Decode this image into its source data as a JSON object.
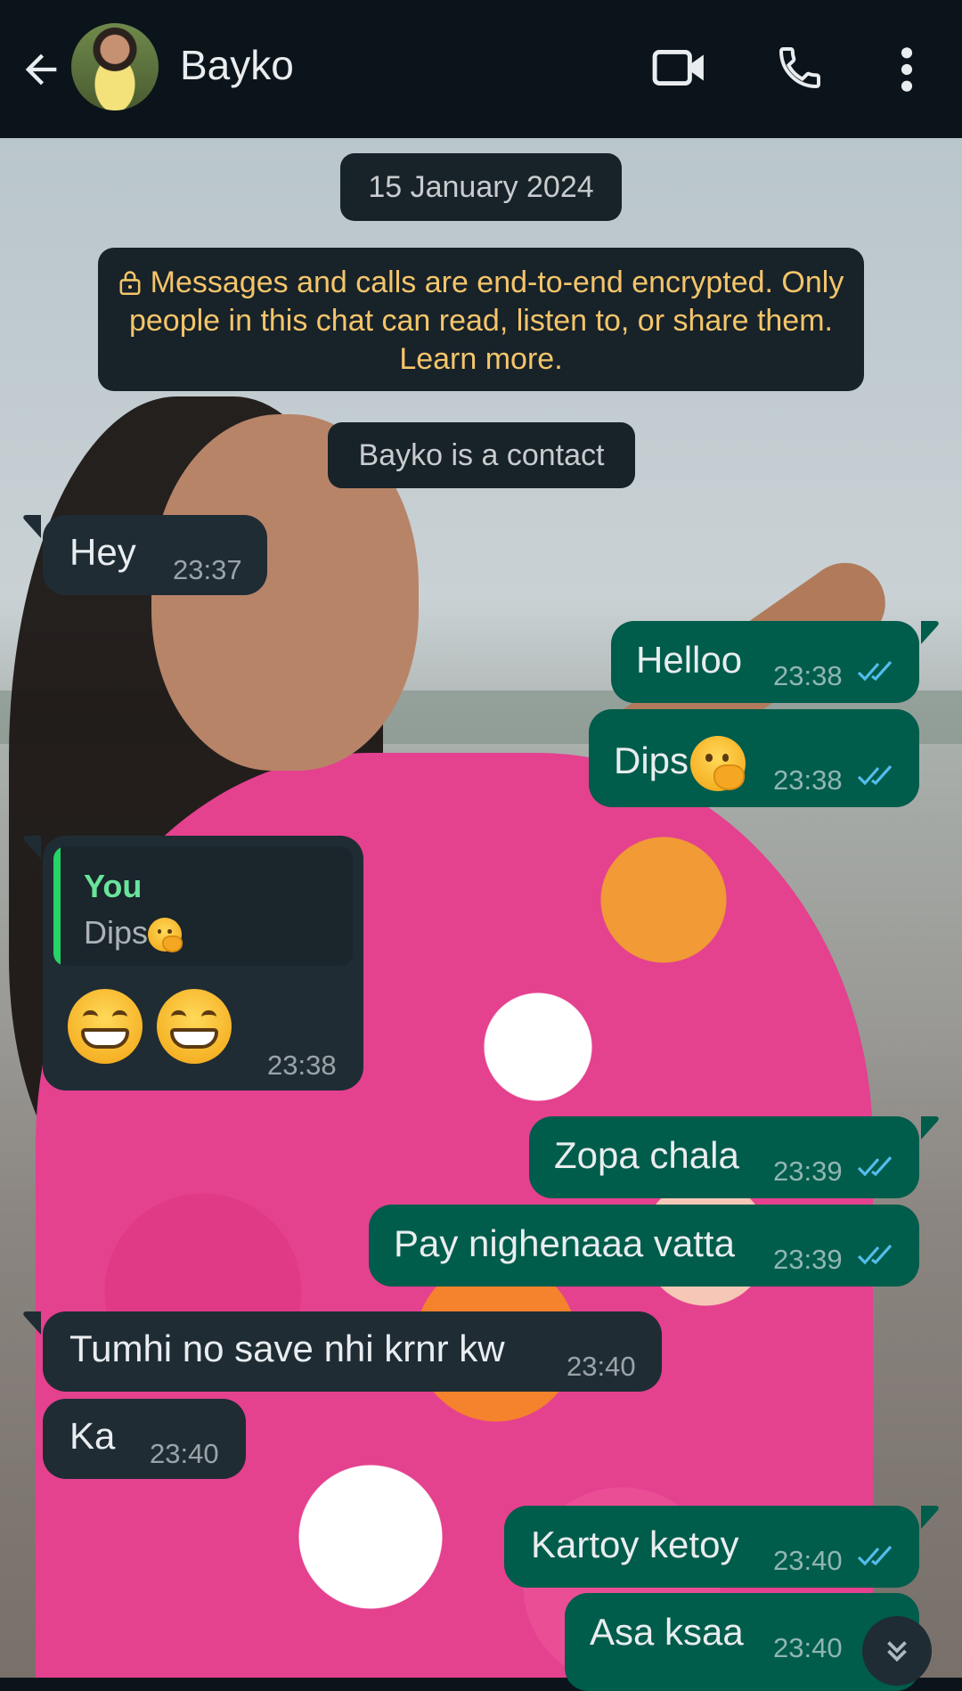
{
  "header": {
    "contact_name": "Bayko",
    "icons": [
      "back-arrow-icon",
      "avatar",
      "video-call-icon",
      "phone-icon",
      "more-options-icon"
    ]
  },
  "chat": {
    "date_label": "15 January 2024",
    "encryption_notice": "Messages and calls are end-to-end encrypted. Only people in this chat can read, listen to, or share them. Learn more.",
    "contact_notice": "Bayko is a contact",
    "messages": [
      {
        "dir": "in",
        "text": "Hey",
        "time": "23:37"
      },
      {
        "dir": "out",
        "text": "Helloo",
        "time": "23:38",
        "status": "read"
      },
      {
        "dir": "out",
        "text": "Dips",
        "emoji": "hand-over-mouth",
        "time": "23:38",
        "status": "read"
      },
      {
        "dir": "in",
        "reply_to": {
          "author": "You",
          "text": "Dips",
          "emoji": "hand-over-mouth"
        },
        "emoji": "grinning-x2",
        "time": "23:38"
      },
      {
        "dir": "out",
        "text": "Zopa chala",
        "time": "23:39",
        "status": "read"
      },
      {
        "dir": "out",
        "text": "Pay nighenaaa vatta",
        "time": "23:39",
        "status": "read"
      },
      {
        "dir": "in",
        "text": "Tumhi no save nhi krnr kw",
        "time": "23:40"
      },
      {
        "dir": "in",
        "text": "Ka",
        "time": "23:40"
      },
      {
        "dir": "out",
        "text": "Kartoy ketoy",
        "time": "23:40",
        "status": "read"
      },
      {
        "dir": "out",
        "text": "Asa ksaa",
        "time": "23:40"
      }
    ]
  },
  "colors": {
    "bar_bg": "#0b141a",
    "incoming_bubble": "#1f2c34",
    "outgoing_bubble": "#005c4b",
    "read_ticks": "#53bdeb",
    "encryption_text": "#f4c56a",
    "reply_author": "#6ae49a"
  }
}
